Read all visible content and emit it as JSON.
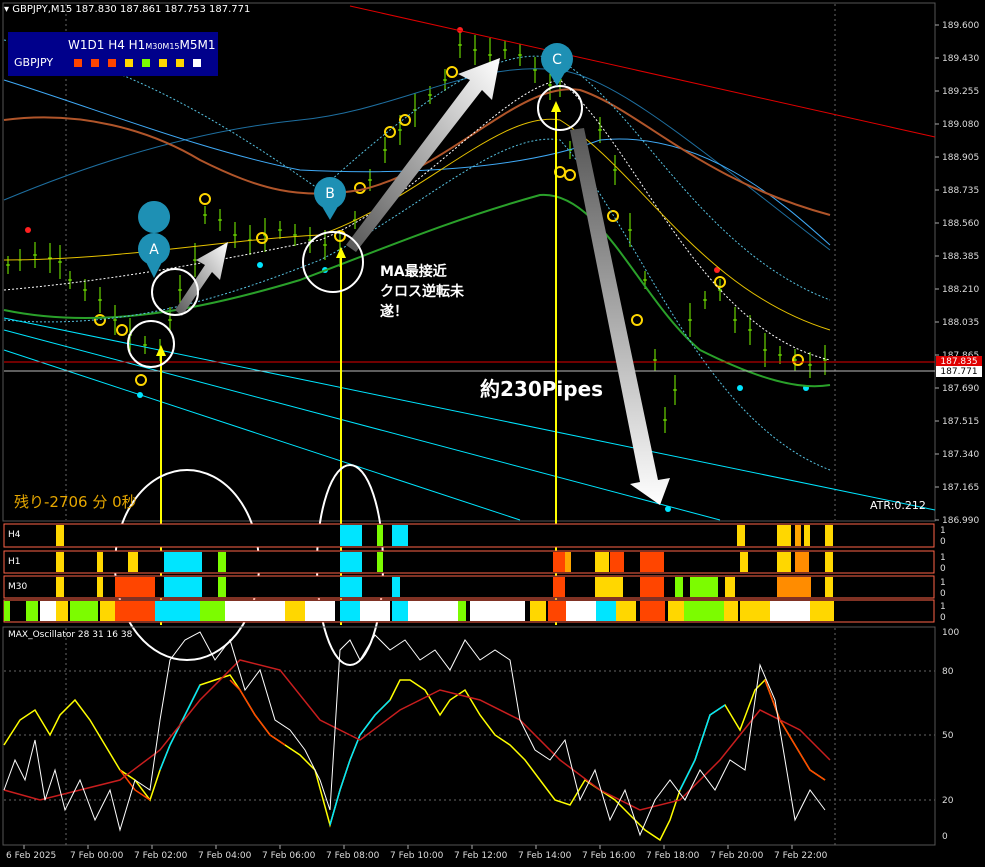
{
  "header": {
    "title": "GBPJPY,M15  187.830 187.861 187.753 187.771"
  },
  "mtf_panel": {
    "timeframes": "W1D1 H4 H1",
    "timeframes_small": "M30M15",
    "timeframes_tail": "M5M1",
    "symbol": "GBPJPY",
    "square_colors": [
      "#ff4500",
      "#ff4500",
      "#ff4500",
      "#ffd700",
      "#7cfc00",
      "#ffd700",
      "#ffd700",
      "#ffffff"
    ]
  },
  "price_axis": {
    "ticks": [
      "189.600",
      "189.430",
      "189.255",
      "189.080",
      "188.905",
      "188.735",
      "188.560",
      "188.385",
      "188.210",
      "188.035",
      "187.865",
      "187.690",
      "187.515",
      "187.340",
      "187.165",
      "186.990"
    ],
    "bid_tag": "187.771",
    "ask_tag": "187.835"
  },
  "annotations": {
    "point_a": "A",
    "point_b": "B",
    "point_c": "C",
    "ma_note_line1": "MA最接近",
    "ma_note_line2": "クロス逆転未",
    "ma_note_line3": "遂！",
    "pips_label": "約230Pipes",
    "countdown": "残り-2706 分 0秒",
    "atr": "ATR:0.212"
  },
  "strips": {
    "rows": [
      {
        "label": "H4",
        "scale_top": "1",
        "scale_bottom": "0"
      },
      {
        "label": "H1",
        "scale_top": "1",
        "scale_bottom": "0"
      },
      {
        "label": "M30",
        "scale_top": "1",
        "scale_bottom": "0"
      },
      {
        "label": "",
        "scale_top": "1",
        "scale_bottom": "0"
      }
    ]
  },
  "oscillator": {
    "title": "MAX_Oscillator 28 31 16 38",
    "ticks": [
      "100",
      "80",
      "50",
      "20",
      "0"
    ]
  },
  "time_axis": {
    "ticks": [
      "6 Feb 2025",
      "7 Feb 00:00",
      "7 Feb 02:00",
      "7 Feb 04:00",
      "7 Feb 06:00",
      "7 Feb 08:00",
      "7 Feb 10:00",
      "7 Feb 12:00",
      "7 Feb 14:00",
      "7 Feb 16:00",
      "7 Feb 18:00",
      "7 Feb 20:00",
      "7 Feb 22:00"
    ]
  },
  "colors": {
    "background": "#000000",
    "candle": "#7cfc00",
    "arrow": "#ffff00",
    "cyan": "#00e5ff",
    "orange": "#ff4500",
    "gold": "#ffd700",
    "osc_yellow": "#ffff00",
    "osc_red": "#c81e1e",
    "resistance": "#e00000",
    "marker_blue": "#1e90b4"
  }
}
